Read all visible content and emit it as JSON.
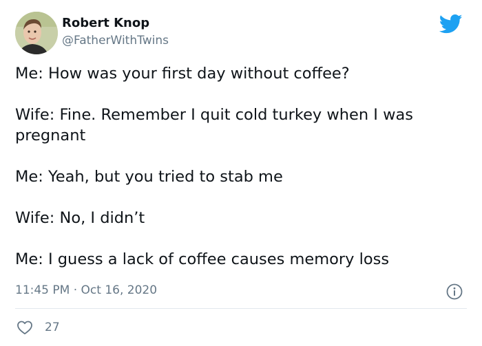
{
  "author": {
    "display_name": "Robert Knop",
    "handle": "@FatherWithTwins",
    "avatar_icon": "profile-photo"
  },
  "brand": {
    "logo_icon": "twitter-bird-icon",
    "color": "#1da1f2"
  },
  "tweet": {
    "lines": [
      "Me: How was your first day without coffee?",
      "Wife: Fine. Remember I quit cold turkey when I was",
      "pregnant",
      "Me: Yeah, but you tried to stab me",
      "Wife: No, I didn’t",
      "Me: I guess a lack of coffee causes memory loss"
    ],
    "time": "11:45 PM",
    "separator": "·",
    "date": "Oct 16, 2020"
  },
  "engagement": {
    "likes": "27",
    "like_icon": "heart-outline-icon",
    "info_icon": "info-icon"
  },
  "colors": {
    "text": "#0f1419",
    "secondary": "#657786",
    "divider": "#e1e8ed"
  }
}
